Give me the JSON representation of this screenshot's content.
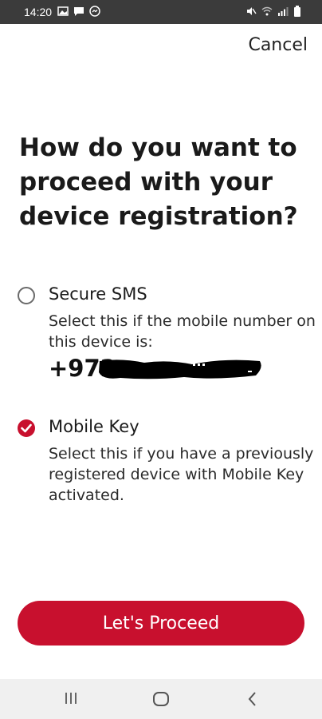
{
  "status_bar": {
    "time": "14:20",
    "left_icons": [
      "image-icon",
      "message-icon",
      "messenger-icon"
    ],
    "right_icons": [
      "mute-icon",
      "wifi-icon",
      "signal-icon",
      "battery-icon"
    ]
  },
  "header": {
    "cancel_label": "Cancel"
  },
  "title": "How do you want to proceed with your device registration?",
  "options": [
    {
      "label": "Secure SMS",
      "description": "Select this if the mobile number on this device is:",
      "phone_prefix": "+972",
      "selected": false
    },
    {
      "label": "Mobile Key",
      "description": "Select this if you have a previously registered device with Mobile Key activated.",
      "selected": true
    }
  ],
  "proceed_button": {
    "label": "Let's Proceed"
  },
  "nav_bar": {
    "icons": [
      "recent-apps-icon",
      "home-icon",
      "back-icon"
    ]
  },
  "colors": {
    "accent": "#c8102e",
    "status_bar": "#3b3b3b",
    "nav_bar": "#f0f0f0"
  }
}
